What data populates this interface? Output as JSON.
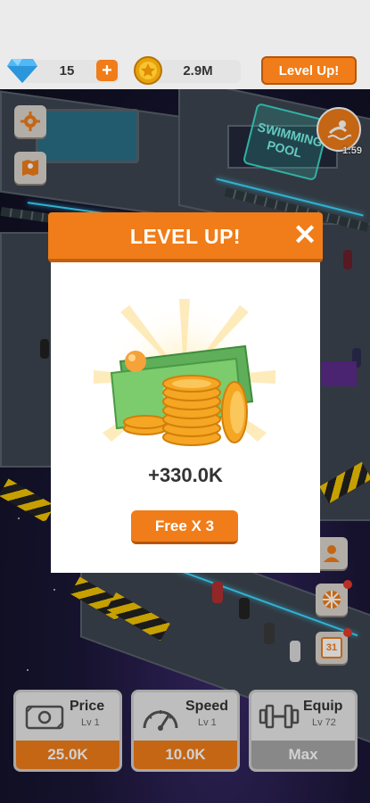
{
  "top_bar": {
    "gems": "15",
    "coins": "2.9M",
    "level_up_label": "Level Up!"
  },
  "scene": {
    "pool_sign": "SWIMMING POOL",
    "event_timer": "1:59"
  },
  "side_buttons": {
    "calendar_day": "31"
  },
  "modal": {
    "title": "LEVEL UP!",
    "reward_amount": "+330.0K",
    "free_button_label": "Free X 3"
  },
  "upgrades": [
    {
      "title": "Price",
      "level": "Lv 1",
      "cost": "25.0K"
    },
    {
      "title": "Speed",
      "level": "Lv 1",
      "cost": "10.0K"
    },
    {
      "title": "Equip",
      "level": "Lv 72",
      "cost": "Max"
    }
  ],
  "colors": {
    "accent": "#f07d19",
    "accent_dark": "#b75508",
    "maxed": "#a6a6a6",
    "neon": "#3cd8ff"
  }
}
